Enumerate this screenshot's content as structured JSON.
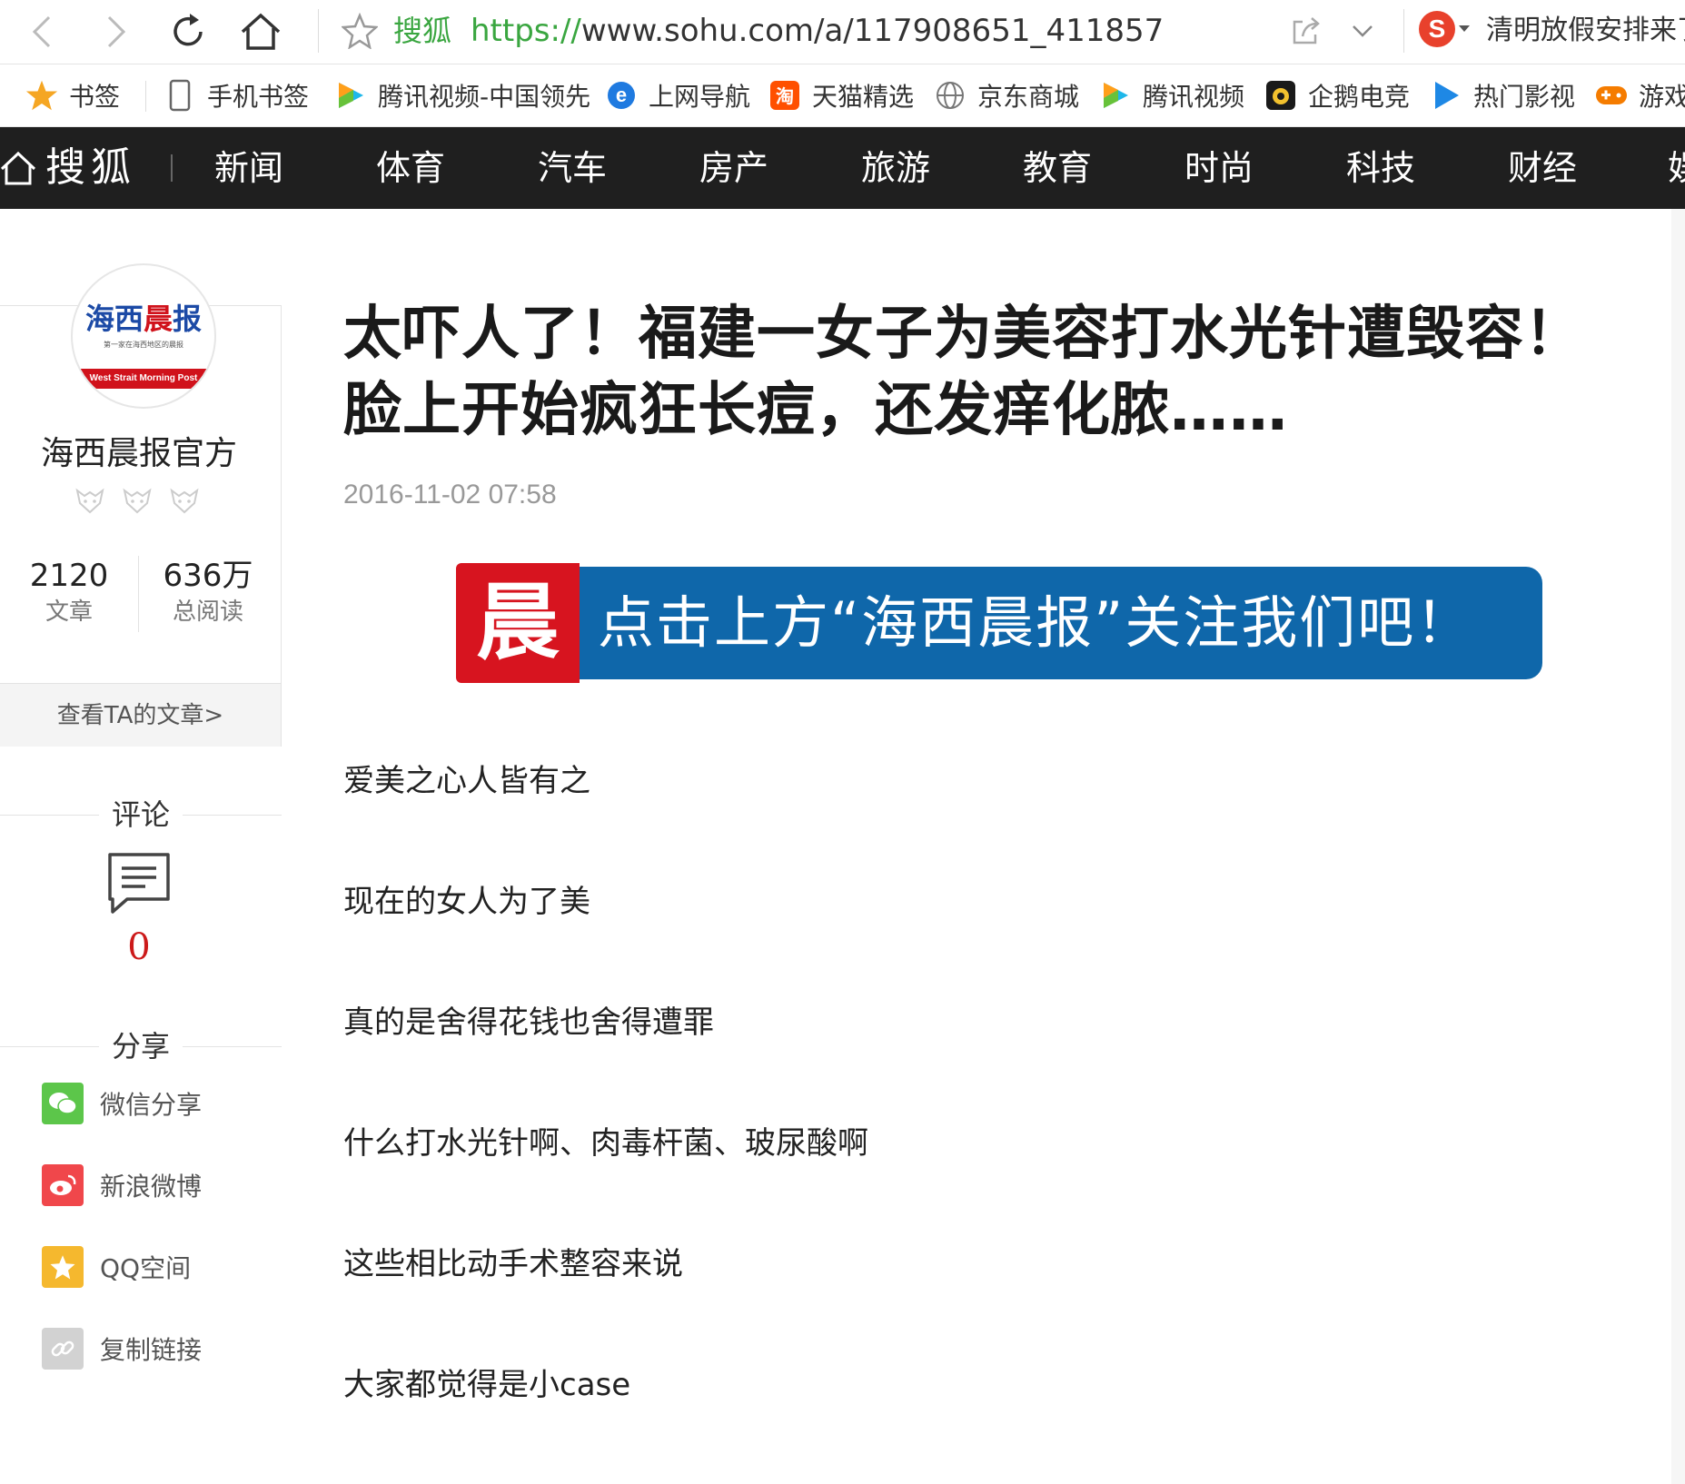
{
  "browser": {
    "site_name": "搜狐",
    "url_protocol": "https://",
    "url_rest": "www.sohu.com/a/117908651_411857",
    "search_hot": "清明放假安排来了",
    "search_logo": "S"
  },
  "bookmarks": [
    {
      "label": "书签",
      "icon": "star-icon"
    },
    {
      "label": "手机书签",
      "icon": "phone-icon"
    },
    {
      "label": "腾讯视频-中国领先",
      "icon": "tencent-video-icon"
    },
    {
      "label": "上网导航",
      "icon": "ie-icon"
    },
    {
      "label": "天猫精选",
      "icon": "taobao-icon"
    },
    {
      "label": "京东商城",
      "icon": "globe-icon"
    },
    {
      "label": "腾讯视频",
      "icon": "tencent-video-icon"
    },
    {
      "label": "企鹅电竞",
      "icon": "penguin-esports-icon"
    },
    {
      "label": "热门影视",
      "icon": "play-icon"
    },
    {
      "label": "游戏",
      "icon": "gamepad-icon"
    }
  ],
  "sohu_nav": {
    "logo": "搜狐",
    "items": [
      "新闻",
      "体育",
      "汽车",
      "房产",
      "旅游",
      "教育",
      "时尚",
      "科技",
      "财经",
      "娱"
    ]
  },
  "author": {
    "avatar_text_blue": "海西",
    "avatar_text_red": "晨",
    "avatar_text_blue2": "报",
    "avatar_sub": "第一家在海西地区的晨报",
    "avatar_band": "West Strait Morning Post",
    "name": "海西晨报官方",
    "articles_count": "2120",
    "articles_label": "文章",
    "reads_count": "636万",
    "reads_label": "总阅读",
    "view_articles": "查看TA的文章>"
  },
  "comments": {
    "heading": "评论",
    "count": "0"
  },
  "share": {
    "heading": "分享",
    "items": [
      {
        "label": "微信分享",
        "color": "#5cc64a"
      },
      {
        "label": "新浪微博",
        "color": "#f0474b"
      },
      {
        "label": "QQ空间",
        "color": "#f5b82e"
      },
      {
        "label": "复制链接",
        "color": "#d2d2d2"
      }
    ]
  },
  "article": {
    "title": "太吓人了！福建一女子为美容打水光针遭毁容！脸上开始疯狂长痘，还发痒化脓……",
    "date": "2016-11-02 07:58",
    "banner_logo": "晨",
    "banner_text": "点击上方“海西晨报”关注我们吧！",
    "paragraphs": [
      "爱美之心人皆有之",
      "现在的女人为了美",
      "真的是舍得花钱也舍得遭罪",
      "什么打水光针啊、肉毒杆菌、玻尿酸啊",
      "这些相比动手术整容来说",
      "大家都觉得是小case"
    ]
  },
  "colors": {
    "accent_green": "#3aa640",
    "nav_bg": "#1f1f1f",
    "banner_blue": "#0f67aa",
    "banner_red": "#d7141f"
  }
}
